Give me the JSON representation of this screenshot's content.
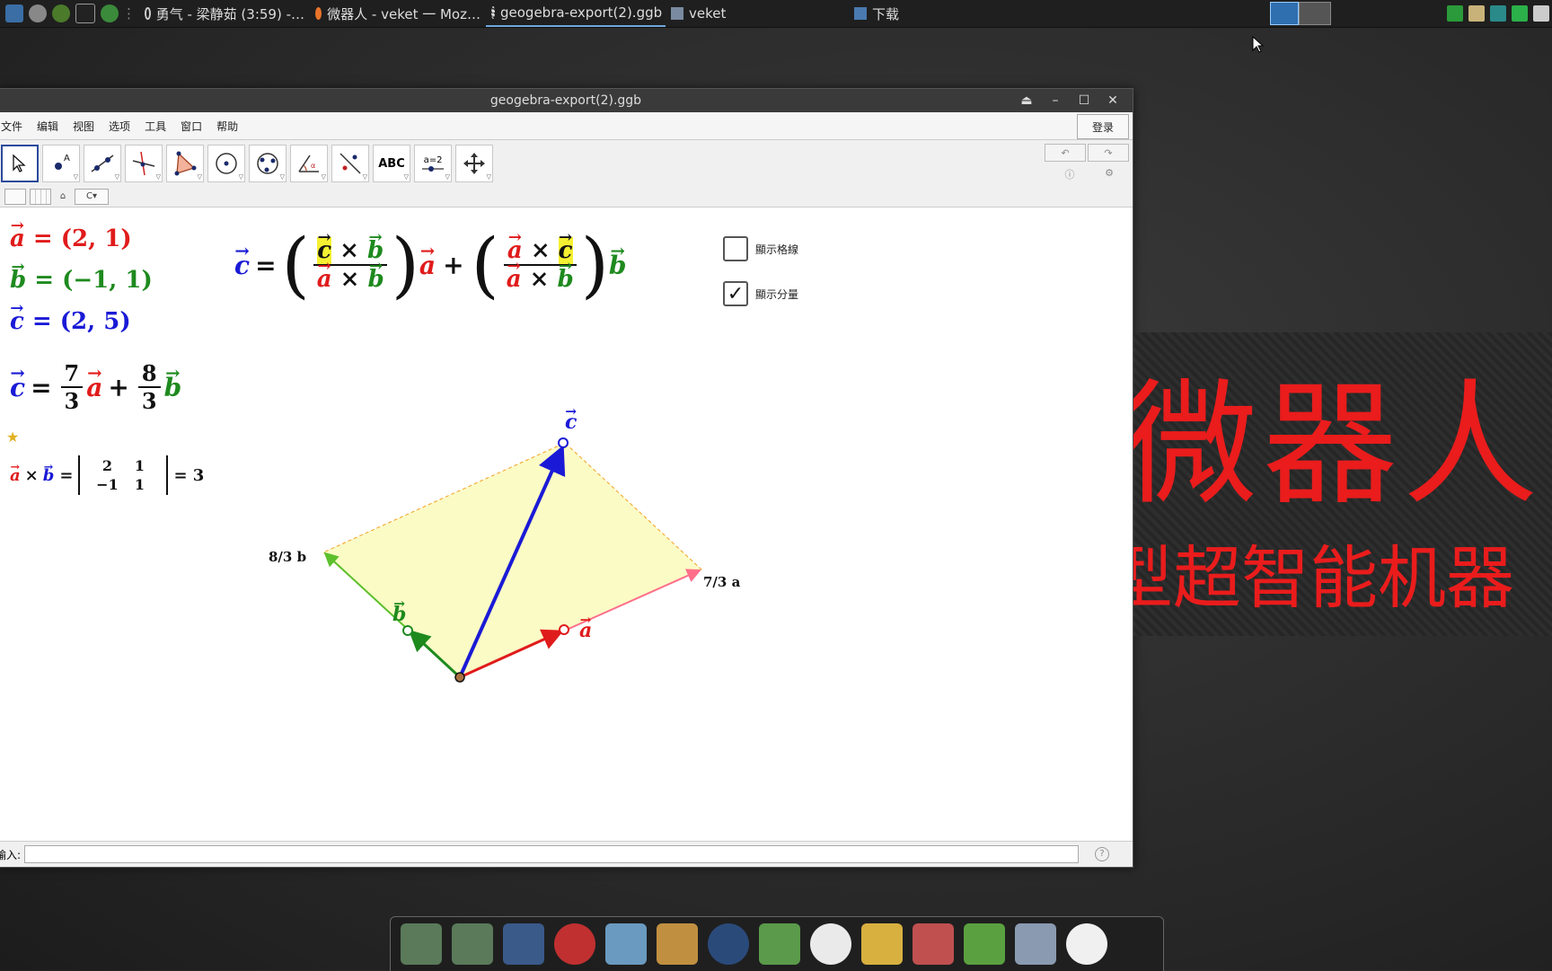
{
  "taskbar": {
    "tasks": [
      {
        "label": "勇气 - 梁静茹 (3:59) -…",
        "active": false
      },
      {
        "label": "微器人 - veket 一 Moz…",
        "active": false
      },
      {
        "label": "geogebra-export(2).ggb",
        "active": true
      },
      {
        "label": "veket",
        "active": false
      },
      {
        "label": "下载",
        "active": false
      }
    ]
  },
  "window": {
    "title": "geogebra-export(2).ggb",
    "controls": [
      "⏏",
      "–",
      "☐",
      "✕"
    ]
  },
  "menu": {
    "items": [
      "文件",
      "编辑",
      "视图",
      "选项",
      "工具",
      "窗口",
      "帮助"
    ],
    "login": "登录"
  },
  "toolbar": {
    "tools": [
      "move-tool",
      "point-tool",
      "line-tool",
      "perpendicular-tool",
      "polygon-tool",
      "circle-tool",
      "circle-3points-tool",
      "angle-tool",
      "reflect-tool",
      "text-tool",
      "slider-tool",
      "move-view-tool"
    ],
    "text_tool_label": "ABC",
    "slider_tool_label": "a=2",
    "undo": "↶",
    "redo": "↷"
  },
  "algebra": {
    "a_def": "= (2, 1)",
    "b_def": "= (−1, 1)",
    "c_def": "= (2, 5)",
    "coef_a_num": "7",
    "coef_a_den": "3",
    "coef_b_num": "8",
    "coef_b_den": "3",
    "det_matrix": [
      [
        "2",
        "1"
      ],
      [
        "−1",
        "1"
      ]
    ],
    "det_value": "= 3"
  },
  "checkboxes": {
    "grid_label": "顯示格線",
    "grid_checked": false,
    "components_label": "顯示分量",
    "components_checked": true
  },
  "graph": {
    "label_c": "c",
    "label_a": "a",
    "label_b": "b",
    "label_ka": "7/3 a",
    "label_kb": "8/3 b"
  },
  "input_bar": {
    "label": "输入:",
    "value": ""
  },
  "banner": {
    "line1": "微器人",
    "line2": "型超智能机器"
  },
  "colors": {
    "vector_a": "#e01b1b",
    "vector_b": "#1e8a1e",
    "vector_c": "#1a1ad6",
    "parallelogram_fill": "#fbfbc6",
    "banner_text": "#ea1c1c"
  }
}
